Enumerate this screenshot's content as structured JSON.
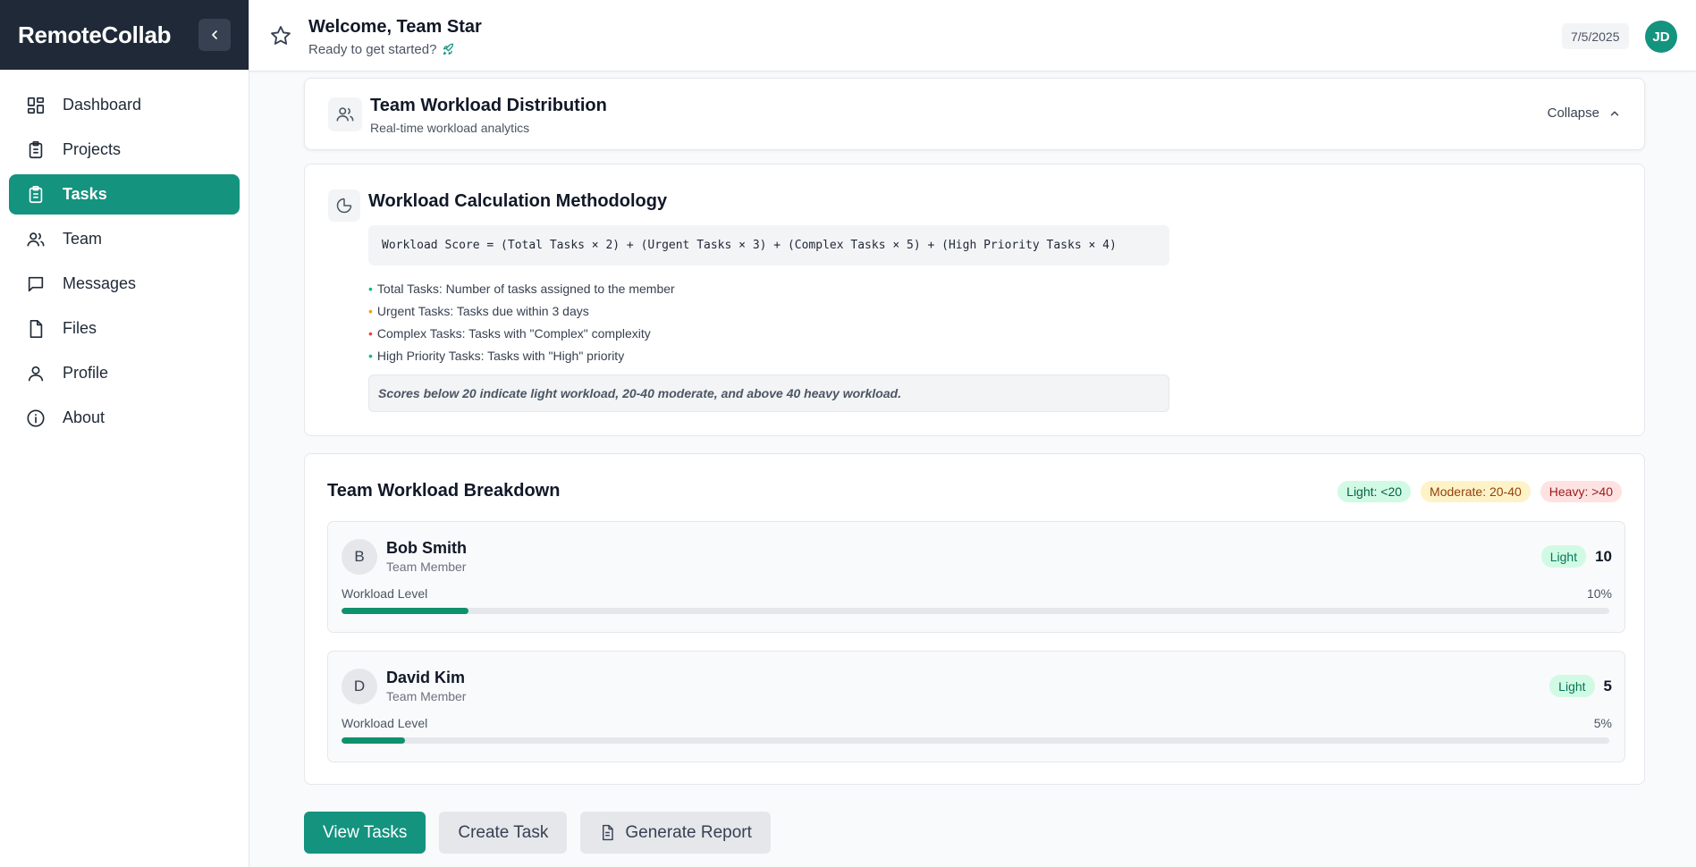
{
  "app": {
    "name": "RemoteCollab"
  },
  "sidebar": {
    "items": [
      {
        "label": "Dashboard",
        "icon": "dashboard-icon",
        "active": false
      },
      {
        "label": "Projects",
        "icon": "clipboard-icon",
        "active": false
      },
      {
        "label": "Tasks",
        "icon": "clipboard-icon",
        "active": true
      },
      {
        "label": "Team",
        "icon": "users-icon",
        "active": false
      },
      {
        "label": "Messages",
        "icon": "message-icon",
        "active": false
      },
      {
        "label": "Files",
        "icon": "file-icon",
        "active": false
      },
      {
        "label": "Profile",
        "icon": "user-icon",
        "active": false
      },
      {
        "label": "About",
        "icon": "info-icon",
        "active": false
      }
    ]
  },
  "header": {
    "welcome": "Welcome, Team Star",
    "subtitle": "Ready to get started?",
    "date": "7/5/2025",
    "user_initials": "JD"
  },
  "distribution": {
    "title": "Team Workload Distribution",
    "subtitle": "Real-time workload analytics",
    "collapse_label": "Collapse"
  },
  "methodology": {
    "title": "Workload Calculation Methodology",
    "formula": "Workload Score = (Total Tasks × 2) + (Urgent Tasks × 3) + (Complex Tasks × 5) + (High Priority Tasks × 4)",
    "bullets": [
      {
        "text": "Total Tasks: Number of tasks assigned to the member",
        "color": "#10b981"
      },
      {
        "text": "Urgent Tasks: Tasks due within 3 days",
        "color": "#f59e0b"
      },
      {
        "text": "Complex Tasks: Tasks with \"Complex\" complexity",
        "color": "#ef4444"
      },
      {
        "text": "High Priority Tasks: Tasks with \"High\" priority",
        "color": "#10b981"
      }
    ],
    "note": "Scores below 20 indicate light workload, 20-40 moderate, and above 40 heavy workload."
  },
  "breakdown": {
    "title": "Team Workload Breakdown",
    "legend": {
      "light": "Light: <20",
      "moderate": "Moderate: 20-40",
      "heavy": "Heavy: >40"
    },
    "workload_label": "Workload Level",
    "members": [
      {
        "initial": "B",
        "name": "Bob Smith",
        "role": "Team Member",
        "level": "Light",
        "score": "10",
        "percent": "10%",
        "fraction": 0.1
      },
      {
        "initial": "D",
        "name": "David Kim",
        "role": "Team Member",
        "level": "Light",
        "score": "5",
        "percent": "5%",
        "fraction": 0.05
      }
    ]
  },
  "actions": {
    "view_tasks": "View Tasks",
    "create_task": "Create Task",
    "generate_report": "Generate Report"
  },
  "colors": {
    "accent": "#14937f",
    "sidebar_header": "#1f2937",
    "progress": "#10916e"
  }
}
